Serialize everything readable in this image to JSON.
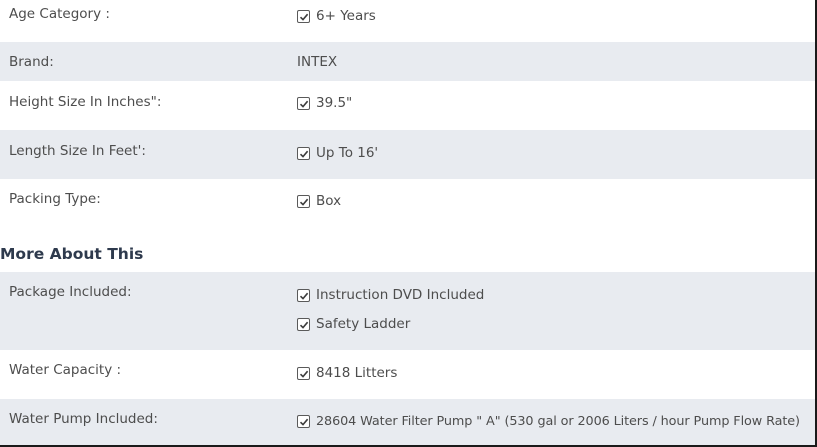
{
  "specs": {
    "age_label": "Age Category :",
    "age_value": "6+ Years",
    "brand_label": "Brand:",
    "brand_value": "INTEX",
    "height_label": "Height Size In Inches\":",
    "height_value": "39.5\"",
    "length_label": "Length Size In Feet':",
    "length_value": "Up To 16'",
    "packing_label": "Packing Type:",
    "packing_value": "Box"
  },
  "more": {
    "heading": "More About This",
    "package_label": "Package Included:",
    "package_values": [
      "Instruction DVD Included",
      "Safety Ladder"
    ],
    "capacity_label": "Water Capacity :",
    "capacity_value": "8418 Litters",
    "pump_label": "Water Pump Included:",
    "pump_value": "28604 Water Filter Pump \" A\" (530 gal or 2006 Liters / hour Pump Flow Rate)"
  },
  "icons": {
    "checkbox": "checkbox-checked-icon"
  }
}
